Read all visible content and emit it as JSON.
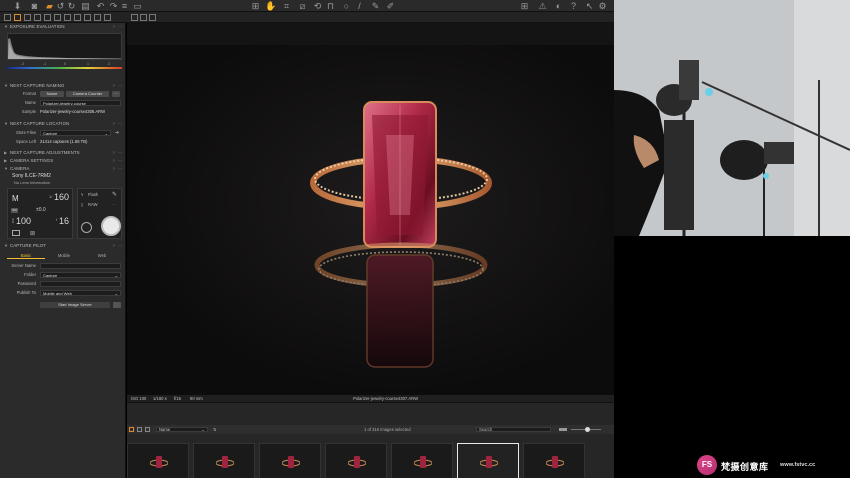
{
  "toolbar": {
    "icons": [
      "import-icon",
      "camera-icon",
      "folder-icon",
      "rotate-left-icon",
      "rotate-right-icon",
      "trash-icon",
      "print-icon",
      "undo-icon",
      "redo-icon",
      "grid-icon",
      "pan-icon",
      "crop-icon",
      "keystone-icon",
      "spot-icon",
      "eyedropper-icon",
      "warning-icon",
      "help-icon",
      "settings-icon"
    ]
  },
  "panel": {
    "exposure_evaluation": "EXPOSURE EVALUATION",
    "histogram_scale": [
      "-2",
      "-1",
      "0",
      "1",
      "2"
    ],
    "next_capture_naming": "NEXT CAPTURE NAMING",
    "format_label": "Format",
    "format_tokens": [
      "Name",
      "Camera Counter"
    ],
    "name_label": "Name",
    "name_value": "Polarizer-jewelry-course",
    "sample_label": "Sample",
    "sample_value": "Polarizer-jewelry-course4308.ARW",
    "next_capture_location": "NEXT CAPTURE LOCATION",
    "store_files_label": "Store Files",
    "store_files_value": "Capture",
    "space_left_label": "Space Left",
    "space_left_value": "21414 captures (1.66 TB)",
    "next_capture_adjustments": "NEXT CAPTURE ADJUSTMENTS",
    "camera_settings": "CAMERA SETTINGS",
    "camera": "CAMERA",
    "camera_model": "Sony ILCE-7RM2",
    "lens_info": "No Lens Information",
    "mode": "M",
    "shutter_prefix": "1/",
    "shutter": "160",
    "ev_offset": "±0.0",
    "iso_prefix": "ISO",
    "iso": "100",
    "aperture_prefix": "f",
    "aperture": "16",
    "flash_label": "Flash",
    "raw_label": "RAW",
    "capture_pilot": "CAPTURE PILOT",
    "tabs": [
      "Basic",
      "Mobile",
      "Web"
    ],
    "server_name_label": "Server Name",
    "folder_label": "Folder",
    "folder_value": "Capture",
    "password_label": "Password",
    "publish_to_label": "Publish To",
    "publish_to_value": "Mobile and Web",
    "start_server": "Start Image Server"
  },
  "viewer": {
    "iso": "ISO 100",
    "shutter": "1/160 s",
    "aperture": "f/16",
    "focal": "90 mm",
    "filename": "Polarizer-jewelry-course4307.ARW"
  },
  "browser": {
    "sort_value": "Name",
    "count_text": "1 of 316 images selected",
    "search_placeholder": "Search",
    "thumbnail_count": 7,
    "selected_index": 5
  },
  "watermark": {
    "badge": "FS",
    "cn_text": "梵摄创意库",
    "url": "www.fstvc.cc"
  }
}
